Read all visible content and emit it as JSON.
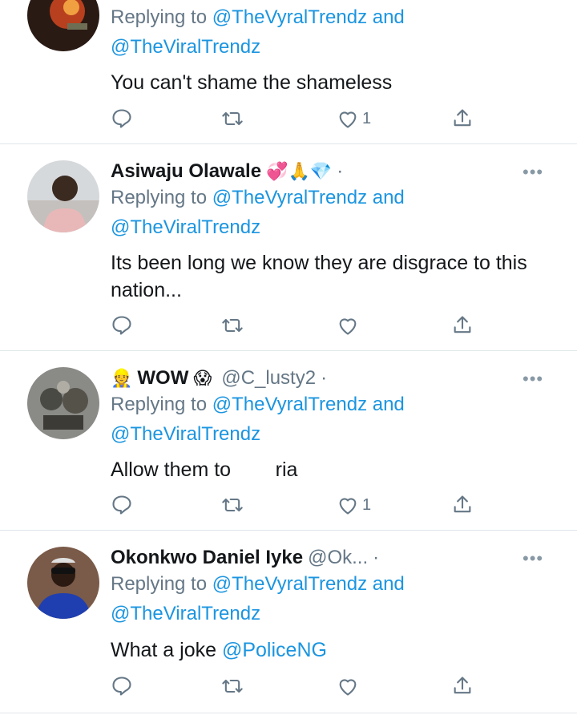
{
  "tweets": [
    {
      "name": "",
      "handle": "",
      "replying_prefix": "Replying to",
      "replying_user1": "@TheVyralTrendz",
      "replying_and": "and",
      "replying_user2": "@TheViralTrendz",
      "text": "You can't shame the shameless",
      "text_link": "",
      "like_count": "1"
    },
    {
      "name": "Asiwaju Olawale",
      "name_emojis": "💞🙏💎",
      "handle": "",
      "replying_prefix": "Replying to",
      "replying_user1": "@TheVyralTrendz",
      "replying_and": "and",
      "replying_user2": "@TheViralTrendz",
      "text": "Its been long we know they are disgrace to this nation...",
      "text_link": "",
      "like_count": ""
    },
    {
      "name": "WOW",
      "name_prefix_emoji": "👷",
      "name_emojis": "😱",
      "handle": "@C_lusty2",
      "replying_prefix": "Replying to",
      "replying_user1": "@TheVyralTrendz",
      "replying_and": "and",
      "replying_user2": "@TheViralTrendz",
      "text": "Allow them to        ria",
      "text_link": "",
      "like_count": "1"
    },
    {
      "name": "Okonkwo Daniel Iyke",
      "handle": "@Ok...",
      "replying_prefix": "Replying to",
      "replying_user1": "@TheVyralTrendz",
      "replying_and": "and",
      "replying_user2": "@TheViralTrendz",
      "text": "What a joke",
      "text_link": "@PoliceNG",
      "like_count": ""
    }
  ],
  "separator_dot": "·",
  "more_label": "•••",
  "icons": [
    "reply-icon",
    "retweet-icon",
    "like-icon",
    "share-icon",
    "more-options-icon"
  ],
  "colors": {
    "link": "#1b95e0",
    "secondary": "#657786",
    "divider": "#e1e6ea"
  }
}
